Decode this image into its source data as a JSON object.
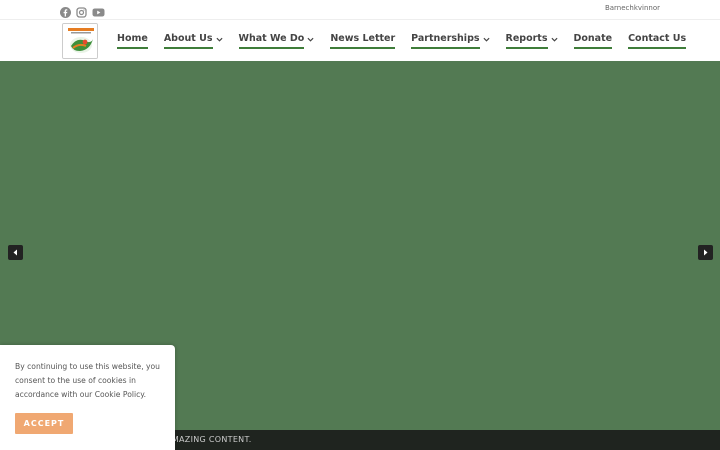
{
  "topbar": {
    "social_icons": [
      "facebook-icon",
      "instagram-icon",
      "youtube-icon"
    ],
    "link": "Barnechkvinnor"
  },
  "nav": {
    "items": [
      {
        "label": "Home",
        "dropdown": false
      },
      {
        "label": "About Us",
        "dropdown": true
      },
      {
        "label": "What We Do",
        "dropdown": true
      },
      {
        "label": "News Letter",
        "dropdown": false
      },
      {
        "label": "Partnerships",
        "dropdown": true
      },
      {
        "label": "Reports",
        "dropdown": true
      },
      {
        "label": "Donate",
        "dropdown": false
      },
      {
        "label": "Contact Us",
        "dropdown": false
      }
    ]
  },
  "bottom_bar": {
    "text": "RE AMAZING CONTENT."
  },
  "cookie": {
    "text": "By continuing to use this website, you consent to the use of cookies in accordance with our Cookie Policy.",
    "accept_label": "ACCEPT"
  },
  "colors": {
    "hero": "#537a53",
    "nav_underline": "#3f7d3a",
    "accept_button": "#f0a872",
    "bottom_bar": "#1f241f"
  }
}
